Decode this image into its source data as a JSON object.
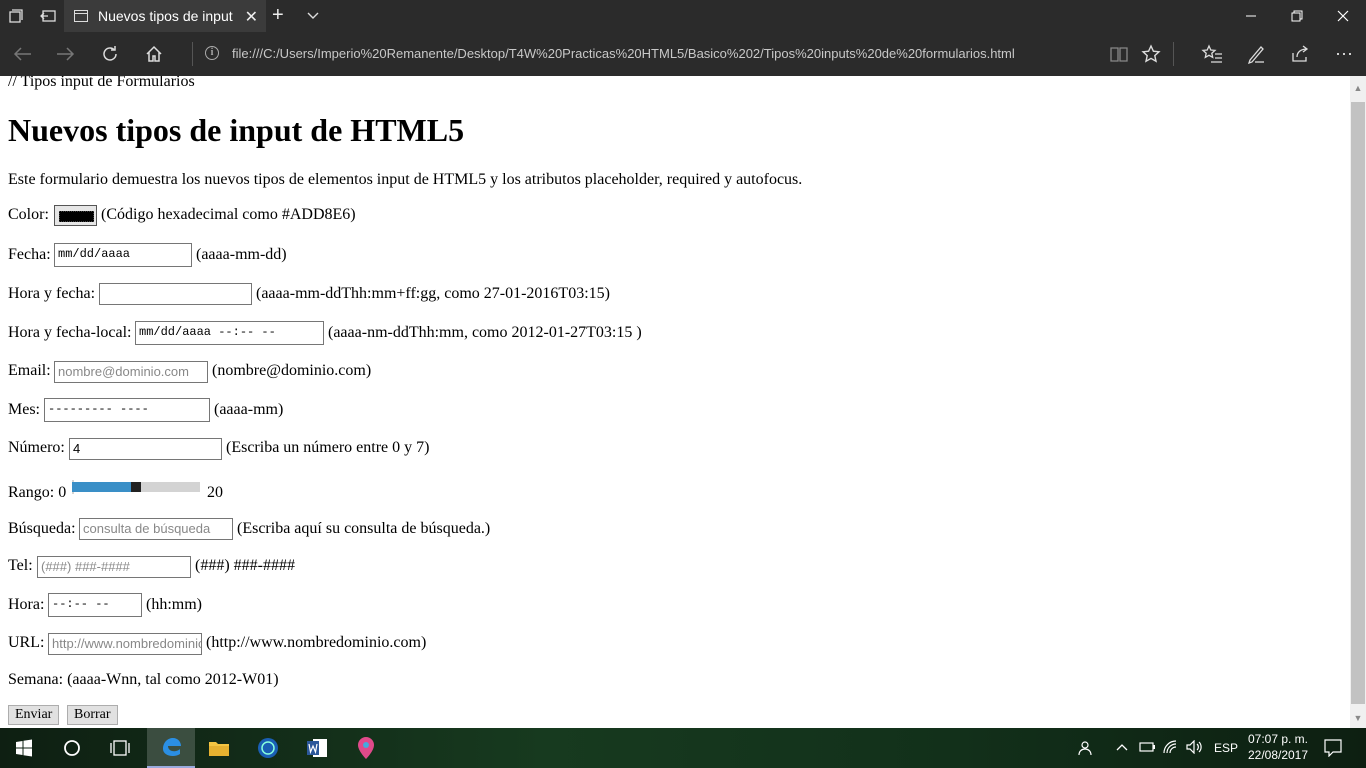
{
  "browser": {
    "tab_title": "Nuevos tipos de input c",
    "url": "file:///C:/Users/Imperio%20Remanente/Desktop/T4W%20Practicas%20HTML5/Basico%202/Tipos%20inputs%20de%20formularios.html"
  },
  "page": {
    "comment": "// Tipos input de Formularios",
    "heading": "Nuevos tipos de input de HTML5",
    "intro": "Este formulario demuestra los nuevos tipos de elementos input de HTML5 y los atributos placeholder, required y autofocus.",
    "color": {
      "label": "Color:",
      "hint": "(Código hexadecimal como #ADD8E6)",
      "value": "#000000"
    },
    "fecha": {
      "label": "Fecha:",
      "value": "mm/dd/aaaa",
      "hint": "(aaaa-mm-dd)"
    },
    "hora_fecha": {
      "label": "Hora y fecha:",
      "value": "",
      "hint": "(aaaa-mm-ddThh:mm+ff:gg, como 27-01-2016T03:15)"
    },
    "hora_fecha_local": {
      "label": "Hora y fecha-local:",
      "value": "mm/dd/aaaa --:-- --",
      "hint": "(aaaa-nm-ddThh:mm, como 2012-01-27T03:15 )"
    },
    "email": {
      "label": "Email:",
      "placeholder": "nombre@dominio.com",
      "hint": "(nombre@dominio.com)"
    },
    "mes": {
      "label": "Mes:",
      "value": "--------- ----",
      "hint": "(aaaa-mm)"
    },
    "numero": {
      "label": "Número:",
      "value": "4",
      "hint": "(Escriba un número entre 0 y 7)"
    },
    "rango": {
      "label": "Rango: 0",
      "max_label": "20",
      "min": 0,
      "max": 20,
      "value": 10
    },
    "busqueda": {
      "label": "Búsqueda:",
      "placeholder": "consulta de búsqueda",
      "hint": "(Escriba aquí su consulta de búsqueda.)"
    },
    "tel": {
      "label": "Tel:",
      "placeholder": "(###) ###-####",
      "hint": "(###) ###-####"
    },
    "hora": {
      "label": "Hora:",
      "value": "--:-- --",
      "hint": "(hh:mm)"
    },
    "url_field": {
      "label": "URL:",
      "placeholder": "http://www.nombredominio.com",
      "hint": "(http://www.nombredominio.com)"
    },
    "semana": {
      "label": "Semana: (aaaa-Wnn, tal como 2012-W01)"
    },
    "buttons": {
      "submit": "Enviar",
      "reset": "Borrar"
    }
  },
  "taskbar": {
    "language": "ESP",
    "time": "07:07 p. m.",
    "date": "22/08/2017"
  }
}
